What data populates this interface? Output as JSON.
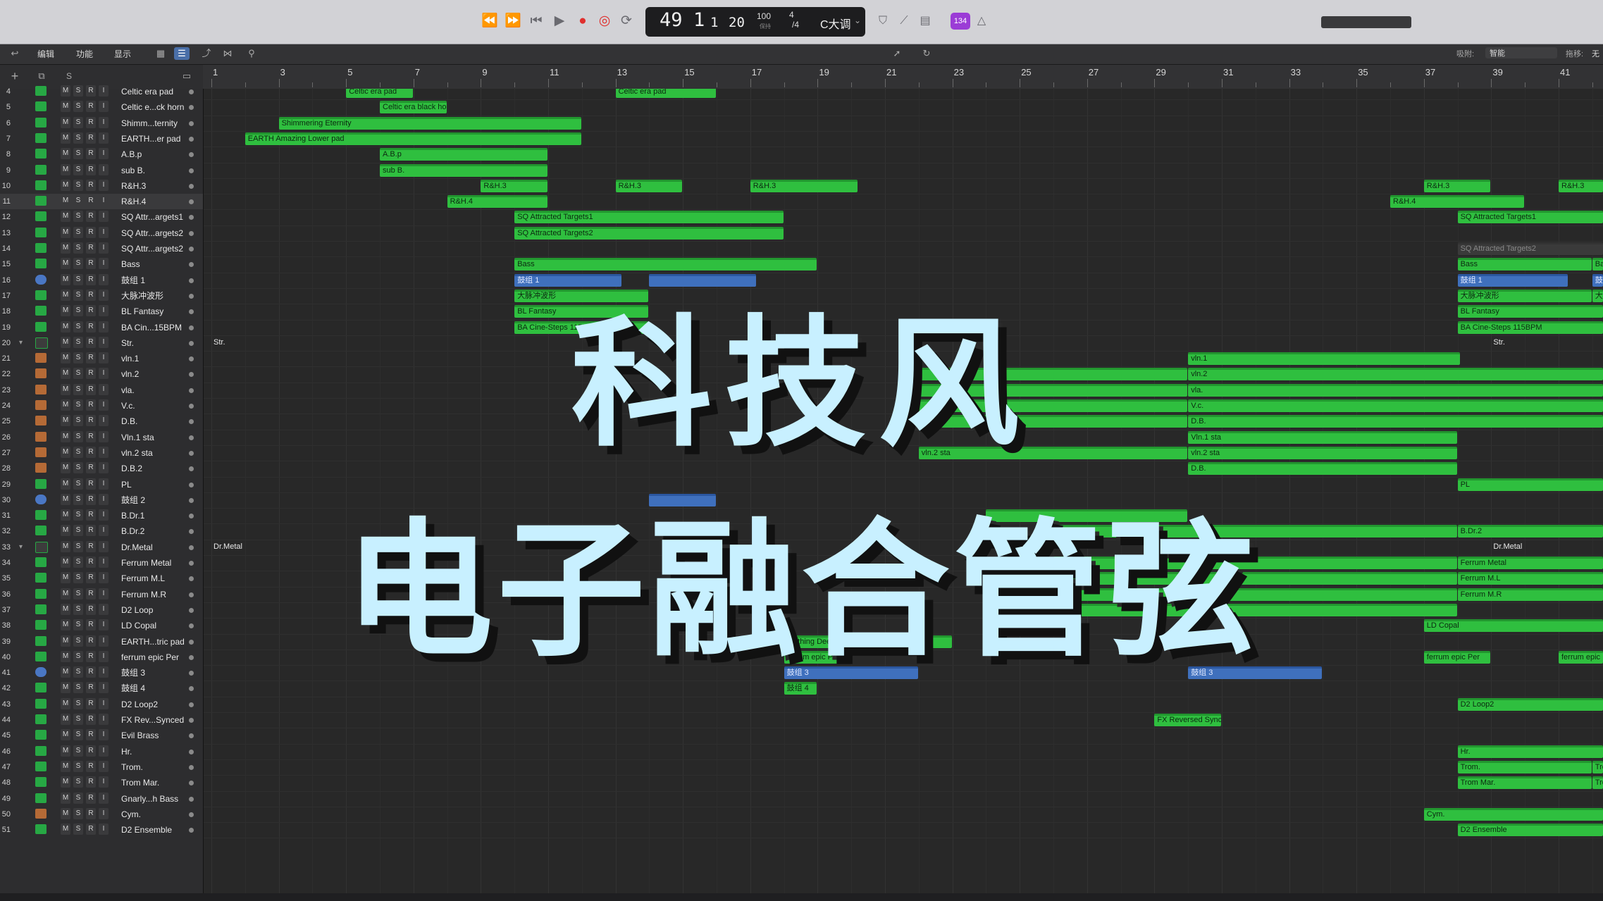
{
  "transport": {
    "lcd": {
      "bar": "49",
      "beat": "1",
      "div": "1",
      "tick": "20",
      "tempo": "100",
      "tempo_label": "保持",
      "sig_top": "4",
      "sig_bottom": "/4",
      "key": "C大调"
    },
    "badge": "134"
  },
  "toolbar": {
    "menus": [
      "编辑",
      "功能",
      "显示"
    ],
    "snap_label": "吸附:",
    "snap_value": "智能",
    "drag_label": "拖移:",
    "drag_value": "无"
  },
  "ruler": [
    "1",
    "3",
    "5",
    "7",
    "9",
    "11",
    "13",
    "15",
    "17",
    "19",
    "21",
    "23",
    "25",
    "27",
    "29",
    "31",
    "33",
    "35",
    "37",
    "39",
    "41"
  ],
  "tracks": [
    {
      "n": "4",
      "name": "Celtic era pad",
      "icon": "green"
    },
    {
      "n": "5",
      "name": "Celtic e...ck horn",
      "icon": "green"
    },
    {
      "n": "6",
      "name": "Shimm...ternity",
      "icon": "green"
    },
    {
      "n": "7",
      "name": "EARTH...er pad",
      "icon": "green"
    },
    {
      "n": "8",
      "name": "A.B.p",
      "icon": "green"
    },
    {
      "n": "9",
      "name": "sub B.",
      "icon": "green"
    },
    {
      "n": "10",
      "name": "R&H.3",
      "icon": "green"
    },
    {
      "n": "11",
      "name": "R&H.4",
      "icon": "green"
    },
    {
      "n": "12",
      "name": "SQ Attr...argets1",
      "icon": "green"
    },
    {
      "n": "13",
      "name": "SQ Attr...argets2",
      "icon": "green"
    },
    {
      "n": "14",
      "name": "SQ Attr...argets2",
      "icon": "green"
    },
    {
      "n": "15",
      "name": "Bass",
      "icon": "green"
    },
    {
      "n": "16",
      "name": "鼓组 1",
      "icon": "drum"
    },
    {
      "n": "17",
      "name": "大脉冲波形",
      "icon": "green"
    },
    {
      "n": "18",
      "name": "BL Fantasy",
      "icon": "green"
    },
    {
      "n": "19",
      "name": "BA Cin...15BPM",
      "icon": "green"
    },
    {
      "n": "20",
      "name": "Str.",
      "icon": "folder"
    },
    {
      "n": "21",
      "name": "vln.1",
      "icon": "inst"
    },
    {
      "n": "22",
      "name": "vln.2",
      "icon": "inst"
    },
    {
      "n": "23",
      "name": "vla.",
      "icon": "inst"
    },
    {
      "n": "24",
      "name": "V.c.",
      "icon": "inst"
    },
    {
      "n": "25",
      "name": "D.B.",
      "icon": "inst"
    },
    {
      "n": "26",
      "name": "Vln.1 sta",
      "icon": "inst"
    },
    {
      "n": "27",
      "name": "vln.2 sta",
      "icon": "inst"
    },
    {
      "n": "28",
      "name": "D.B.2",
      "icon": "inst"
    },
    {
      "n": "29",
      "name": "PL",
      "icon": "green"
    },
    {
      "n": "30",
      "name": "鼓组 2",
      "icon": "drum"
    },
    {
      "n": "31",
      "name": "B.Dr.1",
      "icon": "green"
    },
    {
      "n": "32",
      "name": "B.Dr.2",
      "icon": "green"
    },
    {
      "n": "33",
      "name": "Dr.Metal",
      "icon": "folder"
    },
    {
      "n": "34",
      "name": "Ferrum Metal",
      "icon": "green"
    },
    {
      "n": "35",
      "name": "Ferrum M.L",
      "icon": "green"
    },
    {
      "n": "36",
      "name": "Ferrum M.R",
      "icon": "green"
    },
    {
      "n": "37",
      "name": "D2 Loop",
      "icon": "green"
    },
    {
      "n": "38",
      "name": "LD Copal",
      "icon": "green"
    },
    {
      "n": "39",
      "name": "EARTH...tric pad",
      "icon": "green"
    },
    {
      "n": "40",
      "name": "ferrum epic Per",
      "icon": "green"
    },
    {
      "n": "41",
      "name": "鼓组 3",
      "icon": "drum"
    },
    {
      "n": "42",
      "name": "鼓组 4",
      "icon": "green"
    },
    {
      "n": "43",
      "name": "D2 Loop2",
      "icon": "green"
    },
    {
      "n": "44",
      "name": "FX Rev...Synced",
      "icon": "green"
    },
    {
      "n": "45",
      "name": "Evil Brass",
      "icon": "green"
    },
    {
      "n": "46",
      "name": "Hr.",
      "icon": "green"
    },
    {
      "n": "47",
      "name": "Trom.",
      "icon": "green"
    },
    {
      "n": "48",
      "name": "Trom Mar.",
      "icon": "green"
    },
    {
      "n": "49",
      "name": "Gnarly...h Bass",
      "icon": "green"
    },
    {
      "n": "50",
      "name": "Cym.",
      "icon": "inst"
    },
    {
      "n": "51",
      "name": "D2 Ensemble",
      "icon": "green"
    }
  ],
  "buttons": [
    "M",
    "S",
    "R",
    "I"
  ],
  "regions": [
    {
      "row": 0,
      "s": 5,
      "e": 7,
      "label": "Celtic era pad",
      "c": "green"
    },
    {
      "row": 0,
      "s": 13,
      "e": 16,
      "label": "Celtic era pad",
      "c": "green"
    },
    {
      "row": 1,
      "s": 6,
      "e": 8,
      "label": "Celtic era black ho",
      "c": "green"
    },
    {
      "row": 2,
      "s": 3,
      "e": 12,
      "label": "Shimmering Eternity",
      "c": "green"
    },
    {
      "row": 3,
      "s": 2,
      "e": 12,
      "label": "EARTH Amazing Lower pad",
      "c": "green"
    },
    {
      "row": 4,
      "s": 6,
      "e": 11,
      "label": "A.B.p",
      "c": "green"
    },
    {
      "row": 5,
      "s": 6,
      "e": 11,
      "label": "sub B.",
      "c": "green"
    },
    {
      "row": 6,
      "s": 9,
      "e": 11,
      "label": "R&H.3",
      "c": "green"
    },
    {
      "row": 6,
      "s": 13,
      "e": 15,
      "label": "R&H.3",
      "c": "green"
    },
    {
      "row": 6,
      "s": 17,
      "e": 20.2,
      "label": "R&H.3",
      "c": "green"
    },
    {
      "row": 6,
      "s": 37,
      "e": 39,
      "label": "R&H.3",
      "c": "green"
    },
    {
      "row": 6,
      "s": 41,
      "e": 43,
      "label": "R&H.3",
      "c": "green"
    },
    {
      "row": 7,
      "s": 8,
      "e": 11,
      "label": "R&H.4",
      "c": "green"
    },
    {
      "row": 7,
      "s": 36,
      "e": 40,
      "label": "R&H.4",
      "c": "green"
    },
    {
      "row": 8,
      "s": 10,
      "e": 18,
      "label": "SQ Attracted Targets1",
      "c": "green"
    },
    {
      "row": 8,
      "s": 38,
      "e": 43,
      "label": "SQ Attracted Targets1",
      "c": "green"
    },
    {
      "row": 9,
      "s": 10,
      "e": 18,
      "label": "SQ Attracted Targets2",
      "c": "green"
    },
    {
      "row": 10,
      "s": 38,
      "e": 43,
      "label": "SQ Attracted Targets2",
      "c": "gray"
    },
    {
      "row": 11,
      "s": 10,
      "e": 19,
      "label": "Bass",
      "c": "green"
    },
    {
      "row": 11,
      "s": 38,
      "e": 42,
      "label": "Bass",
      "c": "green"
    },
    {
      "row": 11,
      "s": 42,
      "e": 43,
      "label": "Bass",
      "c": "green"
    },
    {
      "row": 12,
      "s": 10,
      "e": 13.2,
      "label": "鼓组 1",
      "c": "blue"
    },
    {
      "row": 12,
      "s": 14,
      "e": 17.2,
      "label": "",
      "c": "blue"
    },
    {
      "row": 12,
      "s": 38,
      "e": 41.3,
      "label": "鼓组 1",
      "c": "blue"
    },
    {
      "row": 12,
      "s": 42,
      "e": 43,
      "label": "鼓组",
      "c": "blue"
    },
    {
      "row": 13,
      "s": 10,
      "e": 14,
      "label": "大脉冲波形",
      "c": "green"
    },
    {
      "row": 13,
      "s": 38,
      "e": 42,
      "label": "大脉冲波形",
      "c": "green"
    },
    {
      "row": 13,
      "s": 42,
      "e": 43,
      "label": "大脉",
      "c": "green"
    },
    {
      "row": 14,
      "s": 10,
      "e": 14,
      "label": "BL Fantasy",
      "c": "green"
    },
    {
      "row": 14,
      "s": 38,
      "e": 43,
      "label": "BL Fantasy",
      "c": "green"
    },
    {
      "row": 15,
      "s": 10,
      "e": 14,
      "label": "BA Cine-Steps 115BPM",
      "c": "green"
    },
    {
      "row": 15,
      "s": 38,
      "e": 43,
      "label": "BA Cine-Steps 115BPM",
      "c": "green"
    },
    {
      "row": 17,
      "s": 30,
      "e": 38.1,
      "label": "vln.1",
      "c": "green"
    },
    {
      "row": 18,
      "s": 22,
      "e": 30,
      "label": "",
      "c": "green"
    },
    {
      "row": 18,
      "s": 30,
      "e": 43,
      "label": "vln.2",
      "c": "green"
    },
    {
      "row": 19,
      "s": 22,
      "e": 30,
      "label": "",
      "c": "green"
    },
    {
      "row": 19,
      "s": 30,
      "e": 43,
      "label": "vla.",
      "c": "green"
    },
    {
      "row": 20,
      "s": 22,
      "e": 30,
      "label": "",
      "c": "green"
    },
    {
      "row": 20,
      "s": 30,
      "e": 43,
      "label": "V.c.",
      "c": "green"
    },
    {
      "row": 21,
      "s": 22,
      "e": 30,
      "label": "",
      "c": "green"
    },
    {
      "row": 21,
      "s": 30,
      "e": 43,
      "label": "D.B.",
      "c": "green"
    },
    {
      "row": 22,
      "s": 30,
      "e": 38,
      "label": "Vln.1 sta",
      "c": "green"
    },
    {
      "row": 23,
      "s": 22,
      "e": 30,
      "label": "vln.2 sta",
      "c": "green"
    },
    {
      "row": 23,
      "s": 30,
      "e": 38,
      "label": "vln.2 sta",
      "c": "green"
    },
    {
      "row": 24,
      "s": 30,
      "e": 38,
      "label": "D.B.",
      "c": "green"
    },
    {
      "row": 25,
      "s": 38,
      "e": 43,
      "label": "PL",
      "c": "green"
    },
    {
      "row": 26,
      "s": 14,
      "e": 16,
      "label": "",
      "c": "blue"
    },
    {
      "row": 27,
      "s": 24,
      "e": 30,
      "label": "",
      "c": "green"
    },
    {
      "row": 28,
      "s": 26,
      "e": 38,
      "label": "",
      "c": "green"
    },
    {
      "row": 28,
      "s": 38,
      "e": 43,
      "label": "B.Dr.2",
      "c": "green"
    },
    {
      "row": 30,
      "s": 26,
      "e": 38,
      "label": "",
      "c": "green"
    },
    {
      "row": 30,
      "s": 38,
      "e": 43,
      "label": "Ferrum Metal",
      "c": "green"
    },
    {
      "row": 31,
      "s": 26,
      "e": 38,
      "label": "",
      "c": "green"
    },
    {
      "row": 31,
      "s": 38,
      "e": 43,
      "label": "Ferrum M.L",
      "c": "green"
    },
    {
      "row": 32,
      "s": 26,
      "e": 38,
      "label": "",
      "c": "green"
    },
    {
      "row": 32,
      "s": 38,
      "e": 43,
      "label": "Ferrum M.R",
      "c": "green"
    },
    {
      "row": 33,
      "s": 26,
      "e": 38,
      "label": "",
      "c": "green"
    },
    {
      "row": 34,
      "s": 37,
      "e": 43,
      "label": "LD Copal",
      "c": "green"
    },
    {
      "row": 35,
      "s": 17,
      "e": 23,
      "label": "EARTH Breathing Deep Electric pad",
      "c": "green"
    },
    {
      "row": 36,
      "s": 18,
      "e": 20,
      "label": "ferrum epic Per",
      "c": "green"
    },
    {
      "row": 36,
      "s": 37,
      "e": 39,
      "label": "ferrum epic Per",
      "c": "green"
    },
    {
      "row": 36,
      "s": 41,
      "e": 43,
      "label": "ferrum epic Per",
      "c": "green"
    },
    {
      "row": 37,
      "s": 18,
      "e": 22,
      "label": "鼓组 3",
      "c": "blue"
    },
    {
      "row": 37,
      "s": 30,
      "e": 34,
      "label": "鼓组 3",
      "c": "blue"
    },
    {
      "row": 38,
      "s": 18,
      "e": 19,
      "label": "鼓组 4",
      "c": "green"
    },
    {
      "row": 39,
      "s": 38,
      "e": 43,
      "label": "D2 Loop2",
      "c": "green"
    },
    {
      "row": 40,
      "s": 29,
      "e": 31,
      "label": "FX Reversed Synce",
      "c": "green"
    },
    {
      "row": 42,
      "s": 38,
      "e": 43,
      "label": "Hr.",
      "c": "green"
    },
    {
      "row": 43,
      "s": 38,
      "e": 42,
      "label": "Trom.",
      "c": "green"
    },
    {
      "row": 43,
      "s": 42,
      "e": 43,
      "label": "Trom",
      "c": "green"
    },
    {
      "row": 44,
      "s": 38,
      "e": 42,
      "label": "Trom Mar.",
      "c": "green"
    },
    {
      "row": 44,
      "s": 42,
      "e": 43,
      "label": "Trom",
      "c": "green"
    },
    {
      "row": 46,
      "s": 37,
      "e": 43,
      "label": "Cym.",
      "c": "green"
    },
    {
      "row": 47,
      "s": 38,
      "e": 43,
      "label": "D2 Ensemble",
      "c": "green"
    }
  ],
  "folder_labels": [
    {
      "row": 16,
      "bar": 1,
      "label": "Str."
    },
    {
      "row": 16,
      "bar": 39,
      "label": "Str."
    },
    {
      "row": 29,
      "bar": 1,
      "label": "Dr.Metal"
    },
    {
      "row": 29,
      "bar": 39,
      "label": "Dr.Metal"
    }
  ],
  "overlay": {
    "line1": "科技风",
    "line2": "电子融合管弦"
  },
  "colors": {
    "region_green": "#2fbf3f",
    "region_blue": "#3f70bd",
    "overlay_text": "#c8f0ff"
  }
}
